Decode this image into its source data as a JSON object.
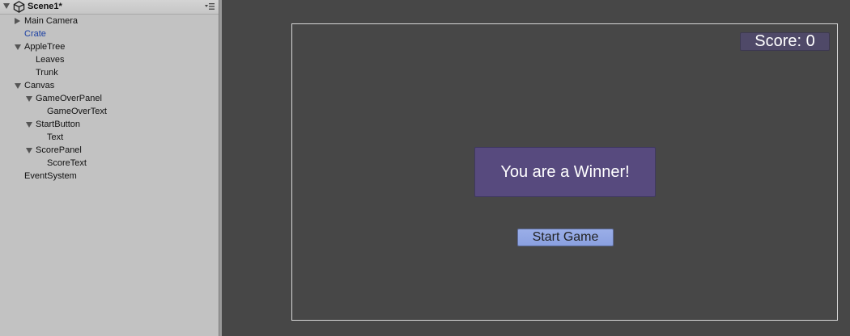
{
  "hierarchy": {
    "scene_title": "Scene1*",
    "items": [
      {
        "label": "Main Camera",
        "indent": 0,
        "arrow": "collapsed",
        "highlight": false
      },
      {
        "label": "Crate",
        "indent": 0,
        "arrow": "none",
        "highlight": true
      },
      {
        "label": "AppleTree",
        "indent": 0,
        "arrow": "expanded",
        "highlight": false
      },
      {
        "label": "Leaves",
        "indent": 1,
        "arrow": "none",
        "highlight": false
      },
      {
        "label": "Trunk",
        "indent": 1,
        "arrow": "none",
        "highlight": false
      },
      {
        "label": "Canvas",
        "indent": 0,
        "arrow": "expanded",
        "highlight": false
      },
      {
        "label": "GameOverPanel",
        "indent": 1,
        "arrow": "expanded",
        "highlight": false
      },
      {
        "label": "GameOverText",
        "indent": 2,
        "arrow": "none",
        "highlight": false
      },
      {
        "label": "StartButton",
        "indent": 1,
        "arrow": "expanded",
        "highlight": false
      },
      {
        "label": "Text",
        "indent": 2,
        "arrow": "none",
        "highlight": false
      },
      {
        "label": "ScorePanel",
        "indent": 1,
        "arrow": "expanded",
        "highlight": false
      },
      {
        "label": "ScoreText",
        "indent": 2,
        "arrow": "none",
        "highlight": false
      },
      {
        "label": "EventSystem",
        "indent": 0,
        "arrow": "none",
        "highlight": false
      }
    ]
  },
  "game": {
    "score_text": "Score: 0",
    "gameover_text": "You are a Winner!",
    "start_button_label": "Start Game"
  },
  "colors": {
    "hierarchy_bg": "#c2c2c2",
    "game_bg": "#474747",
    "score_panel": "#4f4968",
    "gameover_panel": "#574a7e",
    "start_button": "#8aa0e0",
    "highlight_text": "#1a3fa3"
  },
  "icons": {
    "scene": "unity-icon",
    "menu": "panel-menu-icon"
  }
}
